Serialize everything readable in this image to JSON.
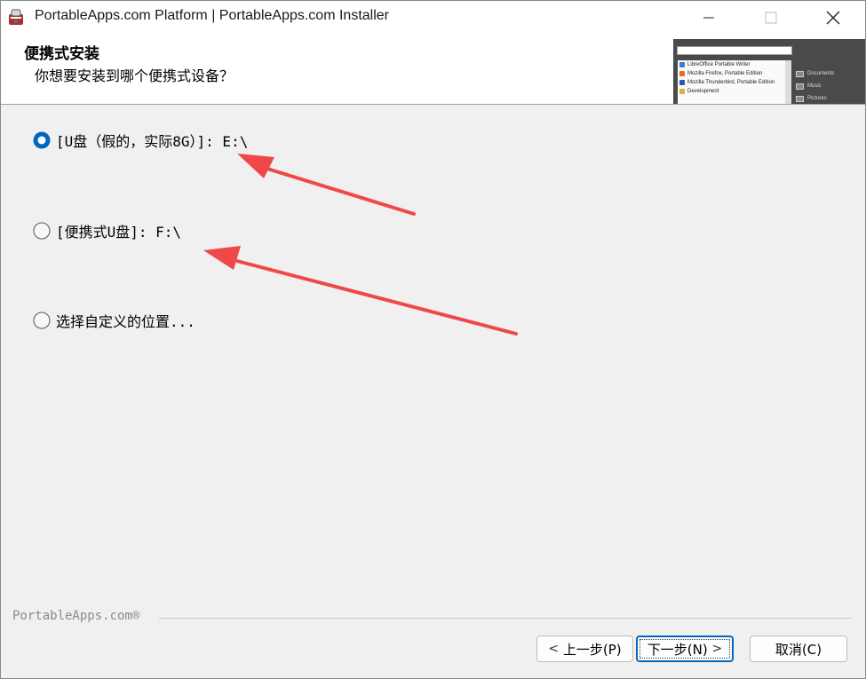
{
  "window": {
    "title": "PortableApps.com Platform | PortableApps.com Installer",
    "controls": {
      "minimize": "minimize",
      "maximize": "maximize",
      "close": "close"
    }
  },
  "header": {
    "title": "便携式安装",
    "subtitle": "你想要安装到哪个便携式设备？",
    "preview": {
      "items": [
        "LibreOffice Portable Writer",
        "Mozilla Firefox, Portable Edition",
        "Mozilla Thunderbird, Portable Edition",
        "Development"
      ],
      "side_items": [
        "Documents",
        "Music",
        "Pictures"
      ]
    }
  },
  "options": [
    {
      "label": "[U盘（假的，实际8G）]: E:\\",
      "selected": true
    },
    {
      "label": "[便携式U盘]: F:\\",
      "selected": false
    },
    {
      "label": "选择自定义的位置...",
      "selected": false
    }
  ],
  "footer": {
    "brand": "PortableApps.com®",
    "back_label": "上一步(P)",
    "next_label": "下一步(N)",
    "cancel_label": "取消(C)"
  },
  "colors": {
    "accent": "#0067c0",
    "annotation_arrow": "#f04848"
  },
  "icons": {
    "app": "portableapps-app-icon",
    "back": "chevron-left-icon",
    "next": "chevron-right-icon"
  }
}
